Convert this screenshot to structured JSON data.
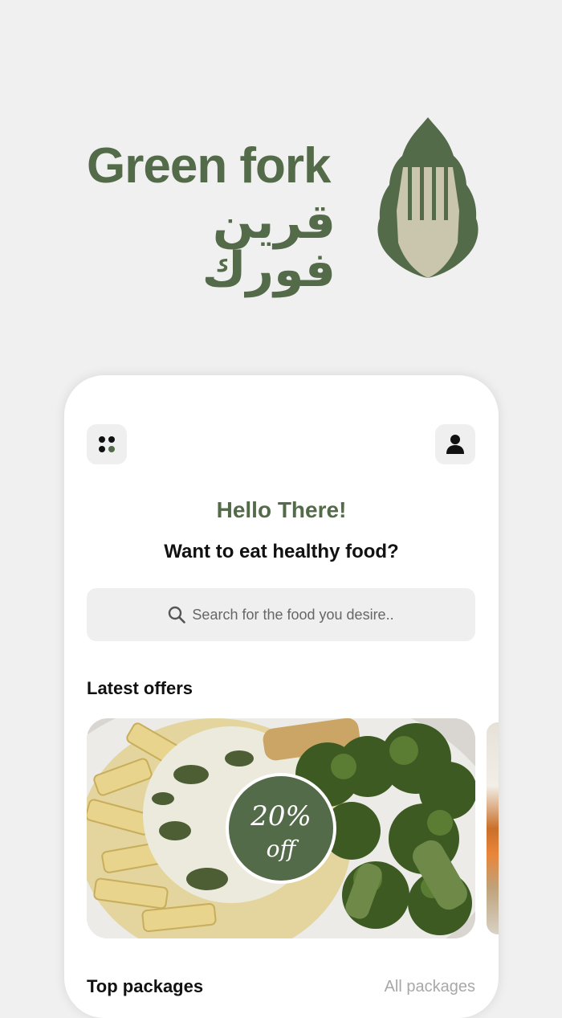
{
  "brand": {
    "name_en": "Green fork",
    "name_ar": "قرين فورك",
    "logo_icon": "leaf-fork-logo",
    "accent_color": "#546b4a"
  },
  "header": {
    "menu_icon": "grid-dots-icon",
    "profile_icon": "user-icon"
  },
  "greeting": {
    "title": "Hello There!",
    "subtitle": "Want to eat healthy food?"
  },
  "search": {
    "icon": "search-icon",
    "placeholder": "Search for the food you desire.."
  },
  "latest_offers": {
    "title": "Latest offers",
    "offers": [
      {
        "discount": "20%",
        "suffix": "off"
      }
    ]
  },
  "top_packages": {
    "title": "Top packages",
    "link": "All packages"
  }
}
